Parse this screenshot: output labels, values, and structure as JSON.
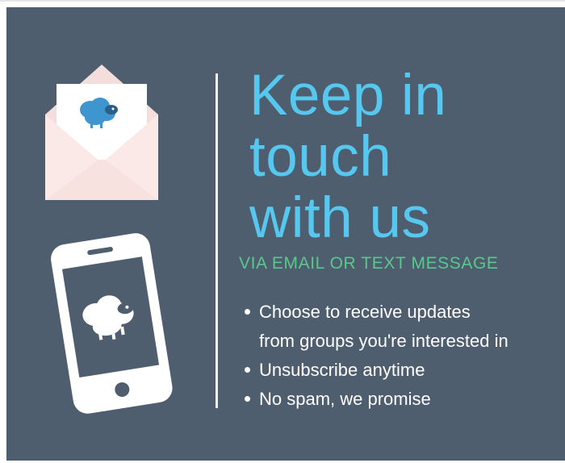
{
  "heading": {
    "line1": "Keep in",
    "line2": "touch",
    "line3": "with us"
  },
  "subheading": "VIA EMAIL OR TEXT MESSAGE",
  "bullets": [
    {
      "line1": "Choose to receive updates",
      "line2": "from groups you're interested in"
    },
    {
      "line1": "Unsubscribe anytime"
    },
    {
      "line1": "No spam, we promise"
    }
  ],
  "icons": {
    "envelope": "envelope-letter-icon",
    "envelope_mark": "sheep-icon",
    "phone": "smartphone-icon",
    "phone_mark": "sheep-icon"
  },
  "colors": {
    "background": "#4f5e6f",
    "heading": "#56c8ef",
    "subheading": "#58c98c",
    "text": "#ffffff",
    "envelope": "#fbe9e7",
    "sheep": "#3e95cf"
  }
}
